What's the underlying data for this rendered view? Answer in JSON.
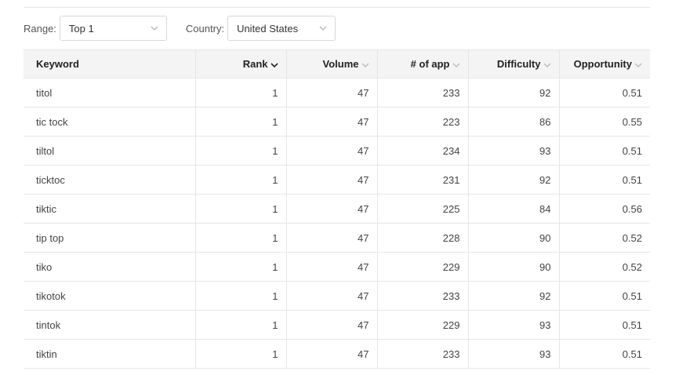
{
  "filters": {
    "range_label": "Range:",
    "range_value": "Top 1",
    "country_label": "Country:",
    "country_value": "United States"
  },
  "table": {
    "columns": [
      "Keyword",
      "Rank",
      "Volume",
      "# of app",
      "Difficulty",
      "Opportunity"
    ],
    "rows": [
      [
        "titol",
        "1",
        "47",
        "233",
        "92",
        "0.51"
      ],
      [
        "tic tock",
        "1",
        "47",
        "223",
        "86",
        "0.55"
      ],
      [
        "tiltol",
        "1",
        "47",
        "234",
        "93",
        "0.51"
      ],
      [
        "ticktoc",
        "1",
        "47",
        "231",
        "92",
        "0.51"
      ],
      [
        "tiktic",
        "1",
        "47",
        "225",
        "84",
        "0.56"
      ],
      [
        "tip top",
        "1",
        "47",
        "228",
        "90",
        "0.52"
      ],
      [
        "tiko",
        "1",
        "47",
        "229",
        "90",
        "0.52"
      ],
      [
        "tikotok",
        "1",
        "47",
        "233",
        "92",
        "0.51"
      ],
      [
        "tintok",
        "1",
        "47",
        "229",
        "93",
        "0.51"
      ],
      [
        "tiktin",
        "1",
        "47",
        "233",
        "93",
        "0.51"
      ]
    ]
  },
  "icons": {
    "select_caret": "chevron-down-icon",
    "sort_caret": "chevron-down-icon"
  },
  "colors": {
    "header_bg": "#f4f4f5",
    "border": "#e6e6e6",
    "sort_active": "#222222",
    "sort_inactive": "#bbbbbb"
  }
}
